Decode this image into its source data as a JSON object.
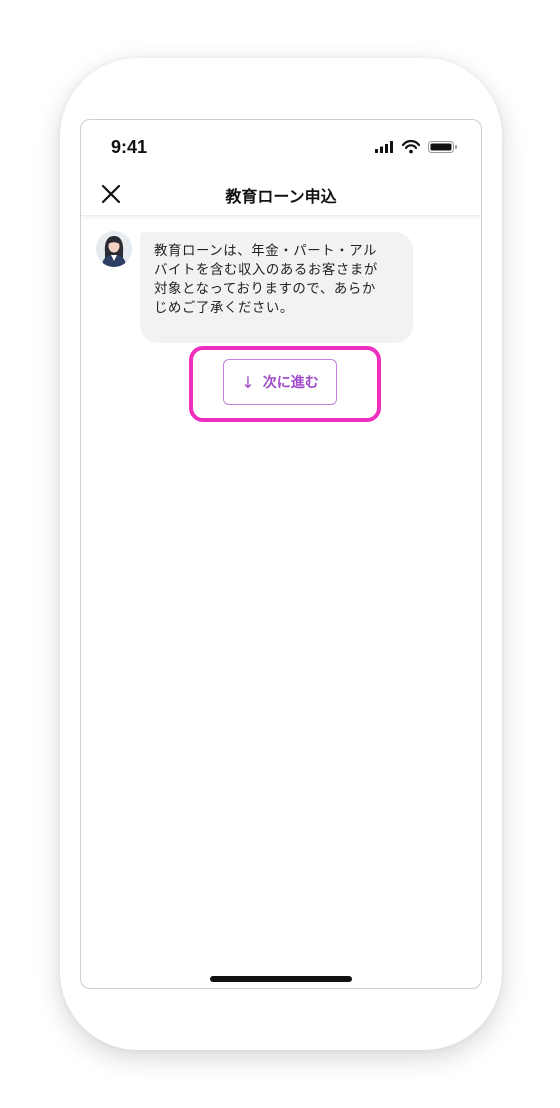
{
  "status_bar": {
    "time": "9:41",
    "icons": [
      "cellular-signal-icon",
      "wifi-icon",
      "battery-icon"
    ]
  },
  "header": {
    "close_icon": "close-icon",
    "title": "教育ローン申込"
  },
  "chat": {
    "avatar": "agent-avatar",
    "message": "教育ローンは、年金・パート・アル\nバイトを含む収入のあるお客さまが\n対象となっておりますので、あらか\nじめご了承ください。"
  },
  "action": {
    "next_label": "次に進む",
    "arrow": "↓"
  },
  "colors": {
    "accent": "#a04bc8",
    "button_border": "#c77fe0",
    "highlight": "#ee2fbf",
    "bubble_bg": "#f2f2f2"
  }
}
